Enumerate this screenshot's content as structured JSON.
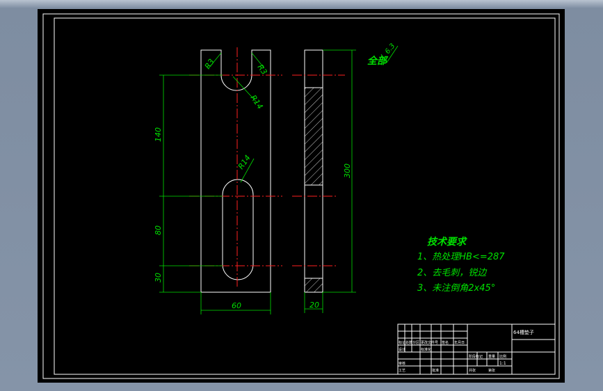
{
  "drawing": {
    "dims": {
      "r3_left": "R3",
      "r3_right": "R3",
      "r14_top": "R14",
      "r14_mid": "R14",
      "d140": "140",
      "d80": "80",
      "d30": "30",
      "width60": "60",
      "thick20": "20",
      "height300": "300"
    },
    "roughness": {
      "label": "全部",
      "value": "6.3"
    },
    "notes": {
      "title": "技术要求",
      "items": [
        "1、热处理HB<=287",
        "2、去毛刺，锐边",
        "3、未注倒角2x45°"
      ]
    }
  },
  "title_block": {
    "part_name": "64槽垫子",
    "labels": [
      "标记",
      "处数",
      "分区",
      "更改文件号",
      "签名",
      "年月日",
      "设计",
      "标准化",
      "阶段标记",
      "重量",
      "比例",
      "审核",
      "工艺",
      "批准",
      "共张",
      "第张"
    ],
    "scale": "1:1"
  },
  "colors": {
    "background": "#000000",
    "outline": "#ffffff",
    "dimension": "#00e000",
    "centerline": "#ff2020",
    "window_bg": "#8594a8"
  }
}
